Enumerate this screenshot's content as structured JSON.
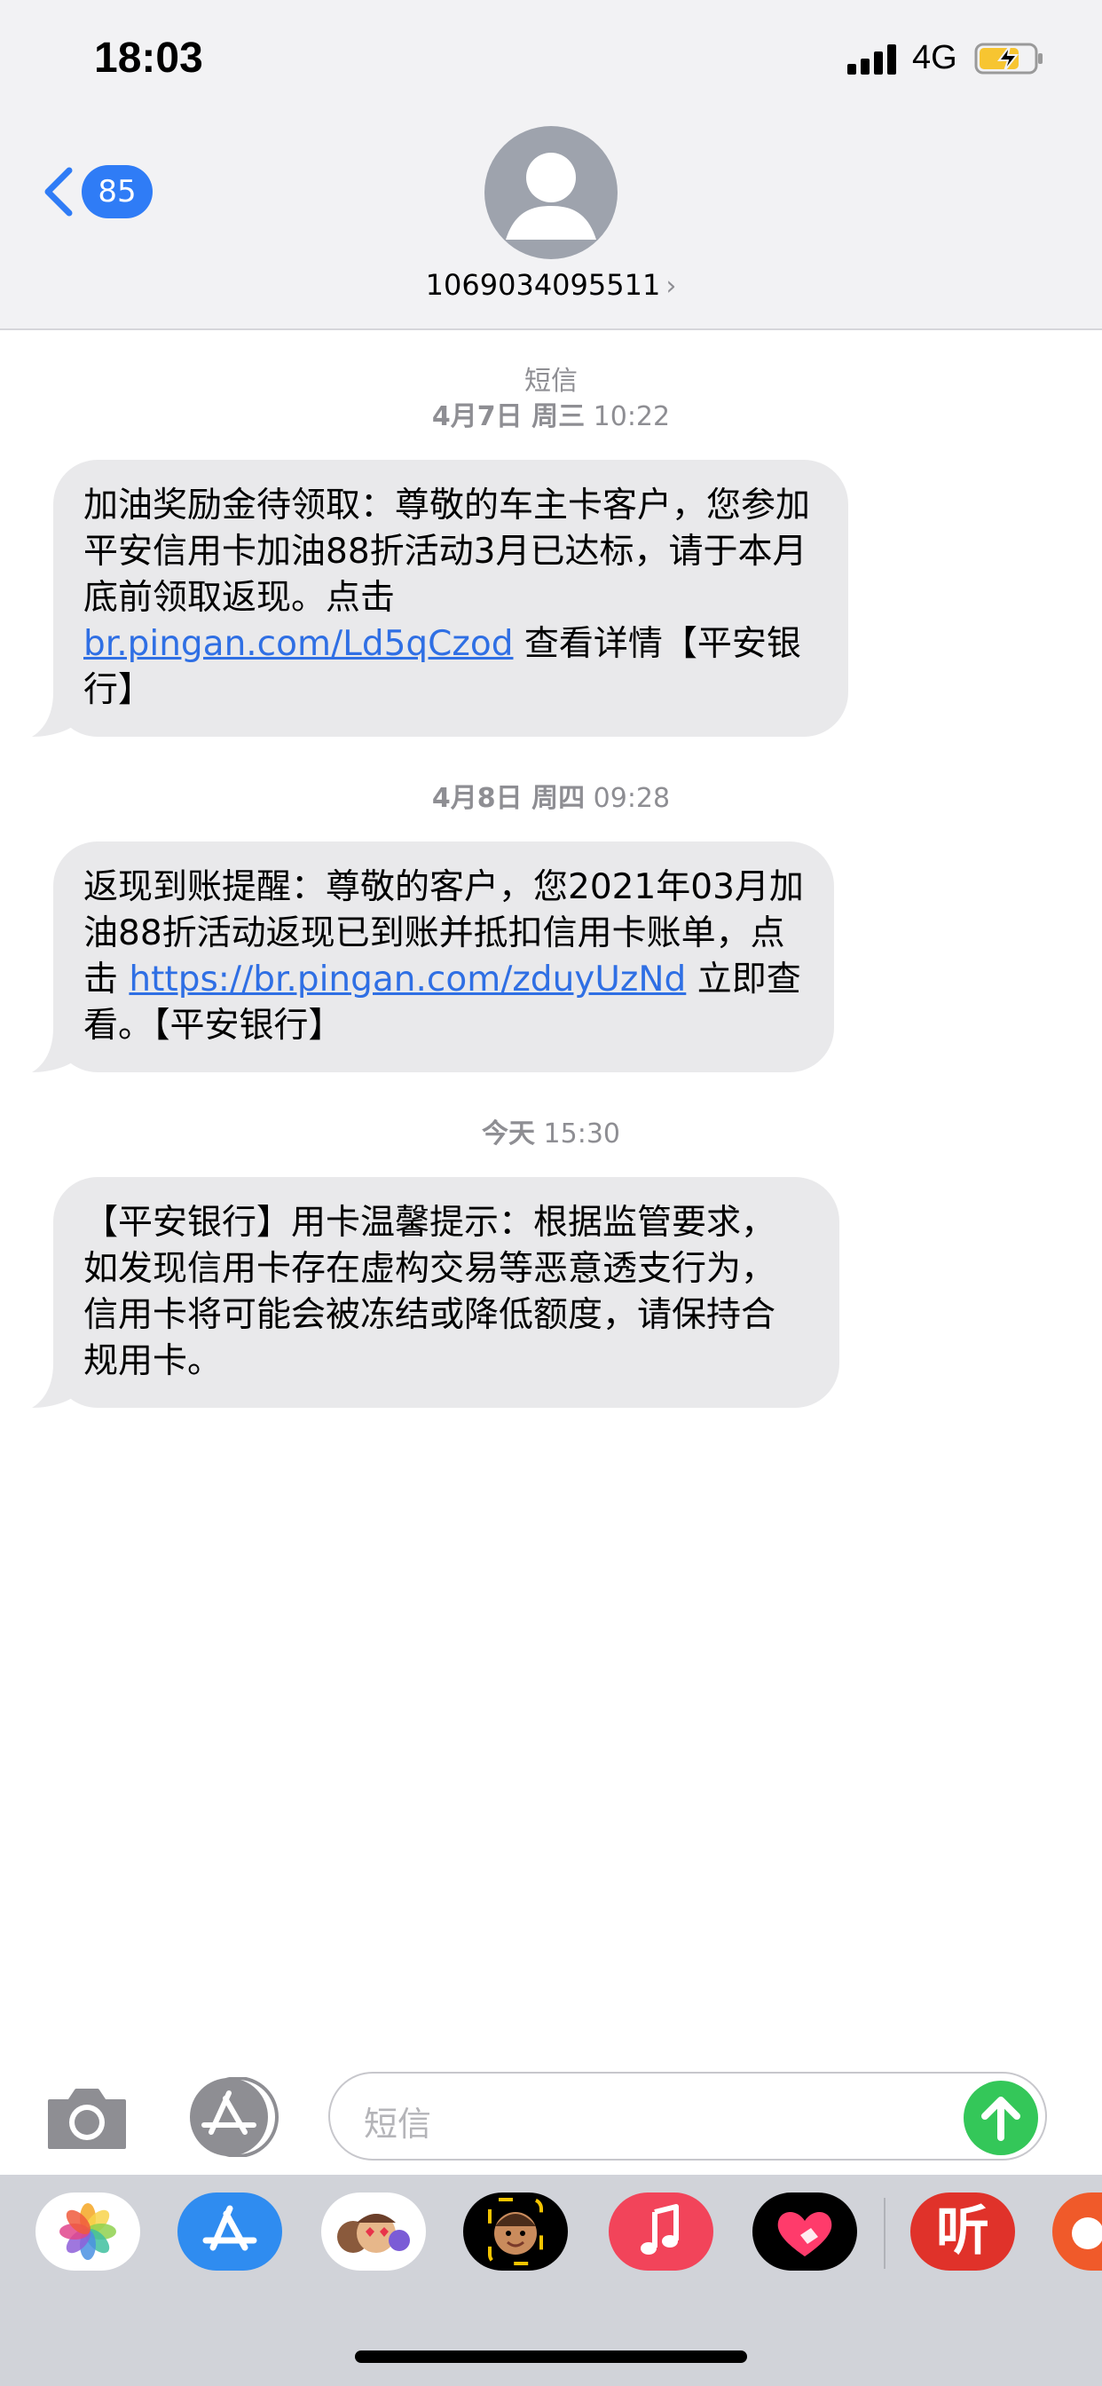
{
  "status_bar": {
    "time": "18:03",
    "network": "4G",
    "icons": [
      "signal-icon",
      "battery-charging-icon"
    ]
  },
  "nav": {
    "back_count": "85",
    "contact_number": "1069034095511",
    "contact_chevron": "›"
  },
  "conversation": {
    "header_label": "短信",
    "messages": [
      {
        "timestamp_date": "4月7日 周三",
        "timestamp_time": "10:22",
        "text_before_link": "加油奖励金待领取：尊敬的车主卡客户，您参加平安信用卡加油88折活动3月已达标，请于本月底前领取返现。点击",
        "link": "br.pingan.com/Ld5qCzod",
        "text_after_link": "查看详情【平安银行】"
      },
      {
        "timestamp_date": "4月8日 周四",
        "timestamp_time": "09:28",
        "text_before_link": "返现到账提醒：尊敬的客户，您2021年03月加油88折活动返现已到账并抵扣信用卡账单，点击",
        "link": "https://br.pingan.com/zduyUzNd",
        "text_after_link": "立即查看。【平安银行】"
      },
      {
        "timestamp_date": "今天",
        "timestamp_time": "15:30",
        "text": "【平安银行】用卡温馨提示：根据监管要求，如发现信用卡存在虚构交易等恶意透支行为，信用卡将可能会被冻结或降低额度，请保持合规用卡。"
      }
    ]
  },
  "input_bar": {
    "placeholder": "短信",
    "icons": [
      "camera-icon",
      "app-store-icon",
      "send-arrow-icon"
    ]
  },
  "app_drawer": {
    "apps": [
      "photos-app-icon",
      "app-store-app-icon",
      "memoji-stickers-app-icon",
      "animoji-app-icon",
      "music-app-icon",
      "digital-touch-app-icon",
      "ting-app-icon",
      "partial-app-icon"
    ],
    "ting_label": "听"
  },
  "colors": {
    "accent_blue": "#2f7cf6",
    "link_blue": "#2f6fe4",
    "bubble_gray": "#e9e9eb",
    "send_green": "#34c759"
  }
}
